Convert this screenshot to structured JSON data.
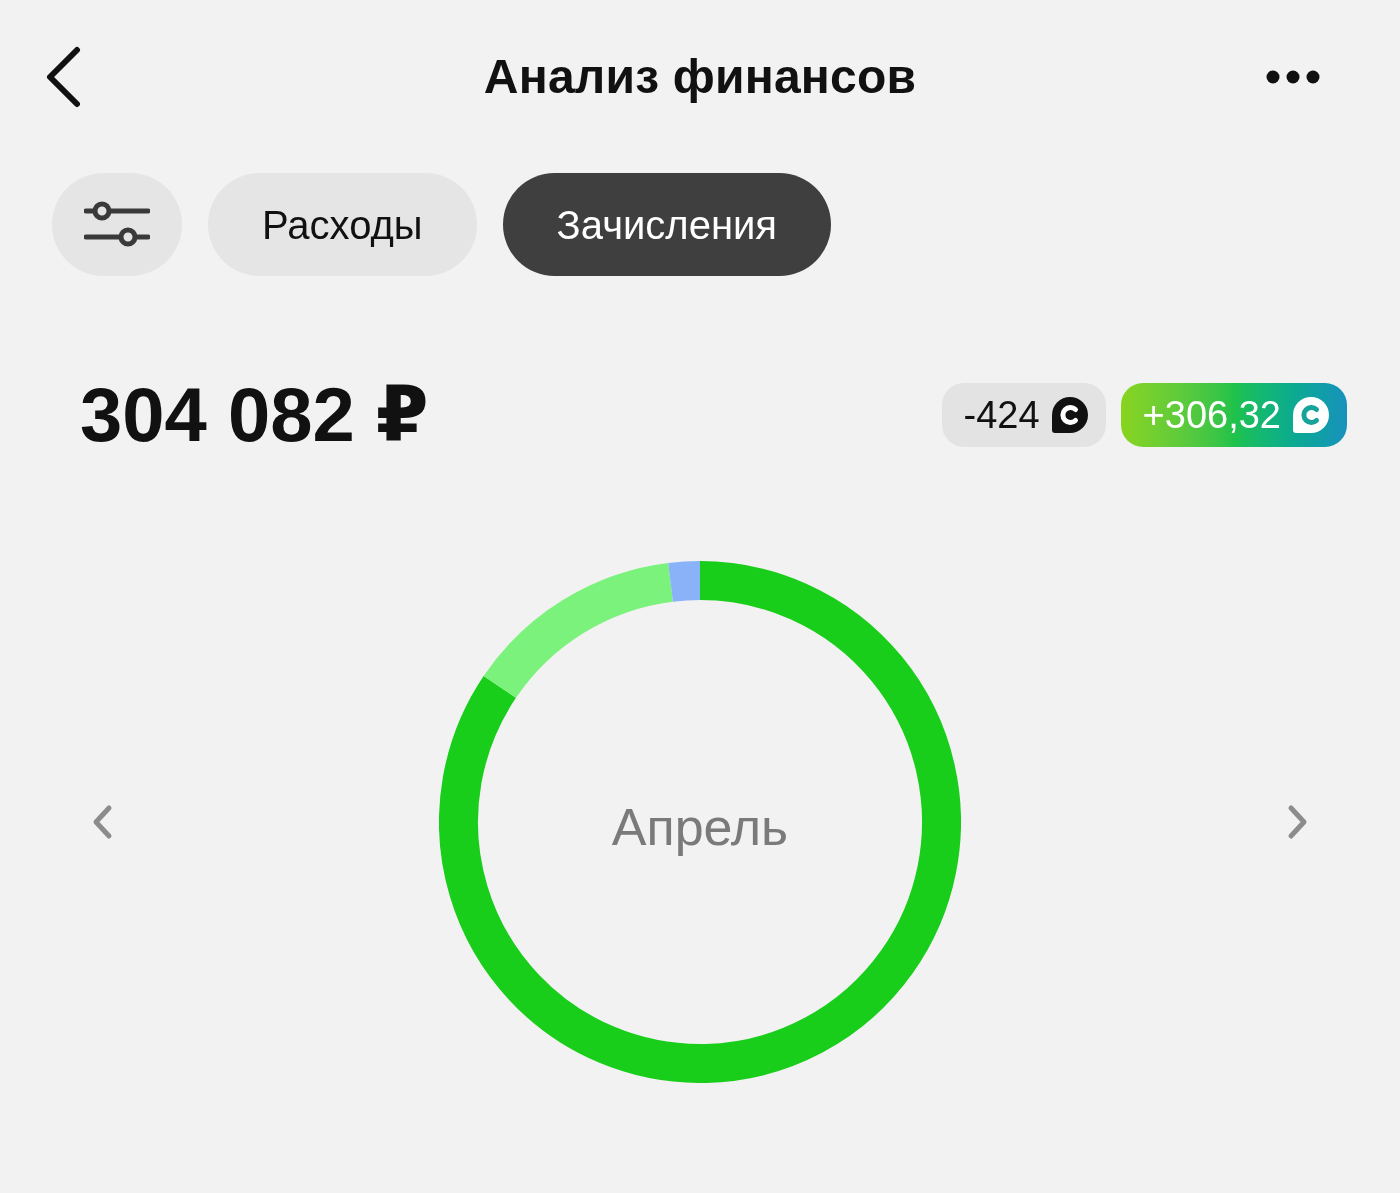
{
  "header": {
    "title": "Анализ финансов"
  },
  "tabs": [
    {
      "label": "Расходы",
      "selected": false
    },
    {
      "label": "Зачисления",
      "selected": true
    }
  ],
  "summary": {
    "total": "304 082 ₽",
    "badges": [
      {
        "kind": "spent",
        "text": "-424"
      },
      {
        "kind": "earned",
        "text": "+306,32"
      }
    ]
  },
  "chart": {
    "center_label": "Апрель"
  }
}
